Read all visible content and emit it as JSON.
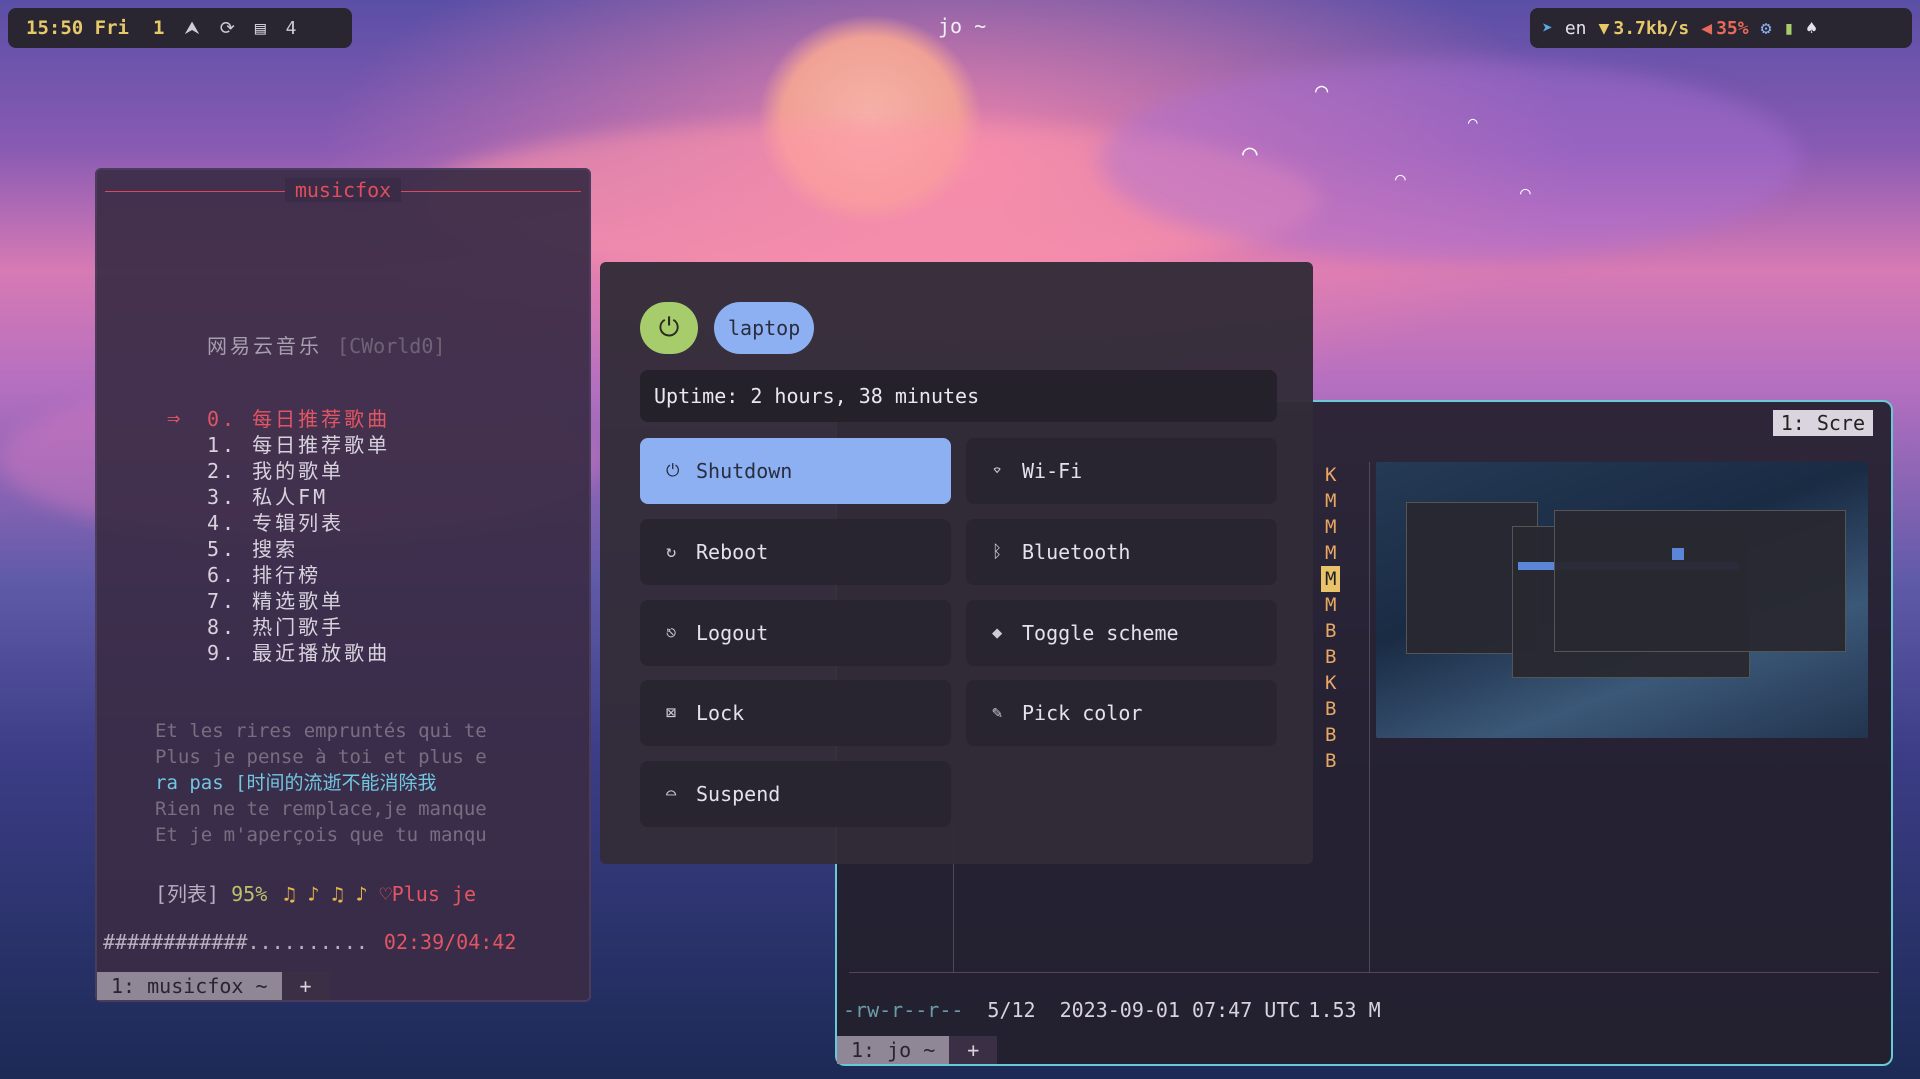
{
  "topbar": {
    "time": "15:50 Fri",
    "workspace": "1",
    "workspace_count": "4",
    "window_title": "jo ~",
    "language": "en",
    "net_speed": "3.7kb/s",
    "volume": "35%",
    "icons": [
      "arch-icon",
      "refresh-icon",
      "notes-icon",
      "telegram-icon",
      "wifi-icon",
      "volume-icon",
      "settings-icon",
      "battery-icon",
      "notification-icon"
    ]
  },
  "musicfox": {
    "title": "musicfox",
    "header": "网易云音乐",
    "user": "[CWorld0]",
    "menu": [
      "0. 每日推荐歌曲",
      "1. 每日推荐歌单",
      "2. 我的歌单",
      "3. 私人FM",
      "4. 专辑列表",
      "5. 搜索",
      "6. 排行榜",
      "7. 精选歌单",
      "8. 热门歌手",
      "9. 最近播放歌曲"
    ],
    "lyrics": [
      "Et les rires empruntés qui te",
      "Plus je pense à toi et plus e",
      "ra pas [时间的流逝不能消除我",
      "Rien ne te remplace,je manque",
      "Et je m'aperçois que tu manqu"
    ],
    "status": {
      "mode": "[列表]",
      "volume": "95%",
      "notes": "♫ ♪ ♫ ♪",
      "song": "Plus je"
    },
    "progress": {
      "bar": "############..........",
      "time": "02:39/04:42",
      "fraction": 0.56
    },
    "tab": "1: musicfox ~",
    "tab_plus": "+"
  },
  "power_menu": {
    "hostname": "laptop",
    "uptime": "Uptime: 2 hours, 38 minutes",
    "buttons": [
      {
        "label": "Shutdown",
        "icon": "power-icon",
        "glyph": "⏻",
        "active": true
      },
      {
        "label": "Wi-Fi",
        "icon": "wifi-icon",
        "glyph": "⌔"
      },
      {
        "label": "Reboot",
        "icon": "reboot-icon",
        "glyph": "↻"
      },
      {
        "label": "Bluetooth",
        "icon": "bluetooth-icon",
        "glyph": "ᛒ"
      },
      {
        "label": "Logout",
        "icon": "logout-icon",
        "glyph": "⎋"
      },
      {
        "label": "Toggle scheme",
        "icon": "paint-bucket-icon",
        "glyph": "◆"
      },
      {
        "label": "Lock",
        "icon": "lock-icon",
        "glyph": "⊠"
      },
      {
        "label": "Pick color",
        "icon": "color-picker-icon",
        "glyph": "✎"
      },
      {
        "label": "Suspend",
        "icon": "bed-icon",
        "glyph": "⌓"
      }
    ],
    "colors": {
      "accent": "#8db0f2",
      "power": "#a6cc6b"
    }
  },
  "file_manager": {
    "tab_title": "1: Scre",
    "file_letters": [
      "K",
      "M",
      "M",
      "M",
      "M",
      "M",
      "B",
      "B",
      "K",
      "B",
      "B",
      "B"
    ],
    "selected_index": 4,
    "status": {
      "permissions": "-rw-r--r--",
      "position": "5/12",
      "modified": "2023-09-01 07:47 UTC",
      "size": "1.53 M"
    },
    "tab": "1: jo ~",
    "tab_plus": "+"
  }
}
